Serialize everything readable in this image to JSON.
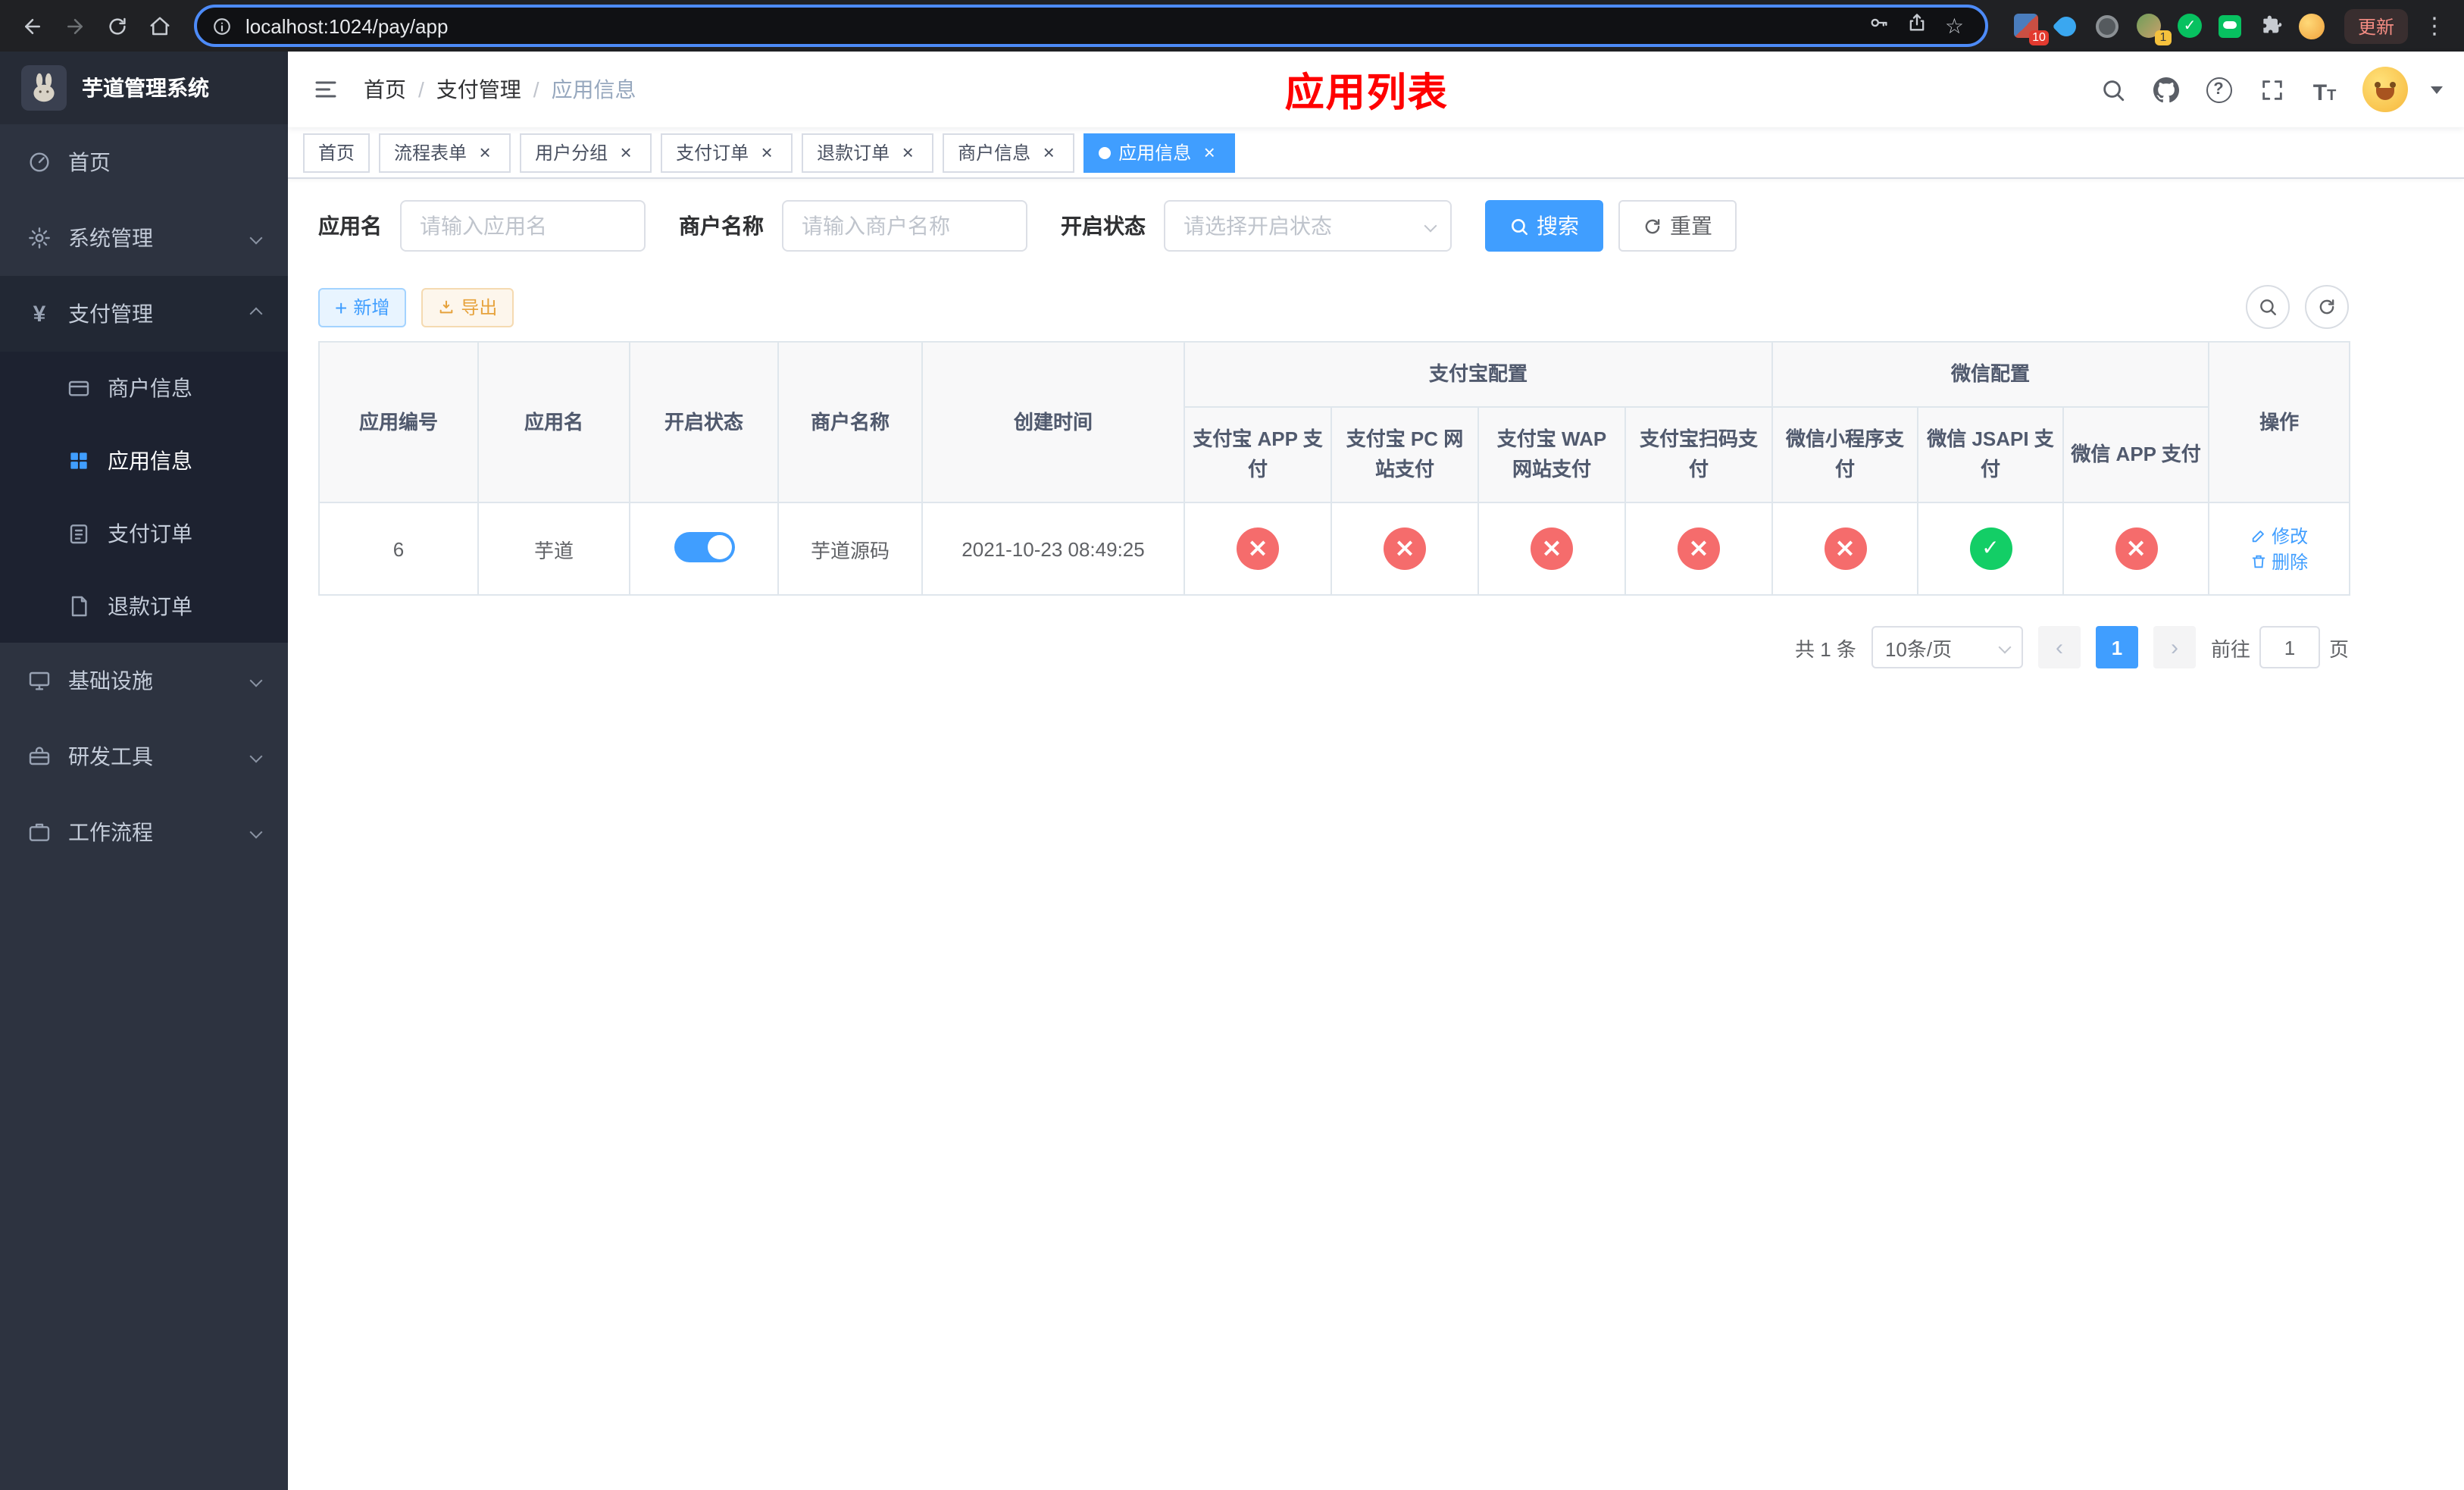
{
  "colors": {
    "primary": "#409eff",
    "page_title_red": "#ff0000",
    "success": "#13ce66",
    "danger": "#f56c6c",
    "warning": "#e6a23c",
    "sidebar_bg": "#2d3340",
    "submenu_bg": "#1d2230"
  },
  "browser": {
    "url": "localhost:1024/pay/app",
    "update_label": "更新",
    "ext_badge_grid": "10",
    "ext_badge_avatar": "1"
  },
  "sidebar": {
    "title": "芋道管理系统",
    "active_item": "应用信息",
    "items": [
      {
        "label": "首页"
      },
      {
        "label": "系统管理"
      },
      {
        "label": "支付管理",
        "children": [
          {
            "label": "商户信息"
          },
          {
            "label": "应用信息"
          },
          {
            "label": "支付订单"
          },
          {
            "label": "退款订单"
          }
        ]
      },
      {
        "label": "基础设施"
      },
      {
        "label": "研发工具"
      },
      {
        "label": "工作流程"
      }
    ]
  },
  "header": {
    "breadcrumb": [
      "首页",
      "支付管理",
      "应用信息"
    ],
    "sep": "/",
    "page_title": "应用列表"
  },
  "tabs": [
    "首页",
    "流程表单",
    "用户分组",
    "支付订单",
    "退款订单",
    "商户信息",
    "应用信息"
  ],
  "active_tab": "应用信息",
  "filters": {
    "app_name_label": "应用名",
    "app_name_placeholder": "请输入应用名",
    "merchant_label": "商户名称",
    "merchant_placeholder": "请输入商户名称",
    "status_label": "开启状态",
    "status_placeholder": "请选择开启状态",
    "search_label": "搜索",
    "reset_label": "重置"
  },
  "toolbar": {
    "add_label": "新增",
    "export_label": "导出"
  },
  "table": {
    "col_app_id": "应用编号",
    "col_app_name": "应用名",
    "col_status": "开启状态",
    "col_merchant": "商户名称",
    "col_created": "创建时间",
    "group_alipay": "支付宝配置",
    "group_wechat": "微信配置",
    "col_alipay_app": "支付宝 APP 支付",
    "col_alipay_pc": "支付宝 PC 网站支付",
    "col_alipay_wap": "支付宝 WAP 网站支付",
    "col_alipay_qr": "支付宝扫码支付",
    "col_wechat_mini": "微信小程序支付",
    "col_wechat_jsapi": "微信 JSAPI 支付",
    "col_wechat_app": "微信 APP 支付",
    "col_actions": "操作",
    "rows": [
      {
        "id": "6",
        "name": "芋道",
        "status": "on",
        "merchant": "芋道源码",
        "created": "2021-10-23 08:49:25",
        "configs": [
          "no",
          "no",
          "no",
          "no",
          "no",
          "yes",
          "no"
        ],
        "edit_label": "修改",
        "delete_label": "删除"
      }
    ]
  },
  "pagination": {
    "total": "共 1 条",
    "page_size": "10条/页",
    "page": "1",
    "goto_prefix": "前往",
    "goto_value": "1",
    "goto_suffix": "页"
  },
  "icons": {
    "close": "×",
    "plus": "+",
    "prev": "‹",
    "next": "›",
    "yen": "¥",
    "dots": "⋮",
    "star": "☆",
    "check": "✓",
    "font_large": "T",
    "font_small": "T"
  }
}
